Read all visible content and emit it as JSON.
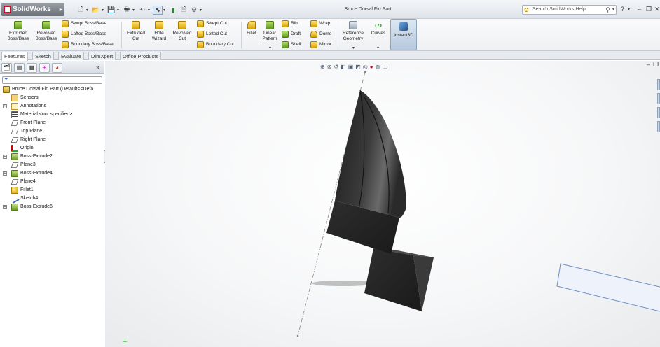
{
  "app": {
    "logo_text": "SolidWorks",
    "document_title": "Bruce Dorsal Fin Part",
    "search_placeholder": "Search SolidWorks Help"
  },
  "ribbon": {
    "extruded_boss": "Extruded Boss/Base",
    "revolved_boss": "Revolved Boss/Base",
    "swept_boss": "Swept Boss/Base",
    "lofted_boss": "Lofted Boss/Base",
    "boundary_boss": "Boundary Boss/Base",
    "extruded_cut": "Extruded Cut",
    "hole_wizard": "Hole Wizard",
    "revolved_cut": "Revolved Cut",
    "swept_cut": "Swept Cut",
    "lofted_cut": "Lofted Cut",
    "boundary_cut": "Boundary Cut",
    "fillet": "Fillet",
    "linear_pattern": "Linear Pattern",
    "rib": "Rib",
    "draft": "Draft",
    "shell": "Shell",
    "wrap": "Wrap",
    "dome": "Dome",
    "mirror": "Mirror",
    "reference_geometry": "Reference Geometry",
    "curves": "Curves",
    "instant3d": "Instant3D"
  },
  "tabs": [
    "Features",
    "Sketch",
    "Evaluate",
    "DimXpert",
    "Office Products"
  ],
  "tree": {
    "root": "Bruce Dorsal Fin Part  (Default<<Defa",
    "items": [
      "Sensors",
      "Annotations",
      "Material <not specified>",
      "Front Plane",
      "Top Plane",
      "Right Plane",
      "Origin",
      "Boss-Extrude2",
      "Plane3",
      "Boss-Extrude4",
      "Plane4",
      "Fillet1",
      "Sketch4",
      "Boss-Extrude6"
    ]
  }
}
